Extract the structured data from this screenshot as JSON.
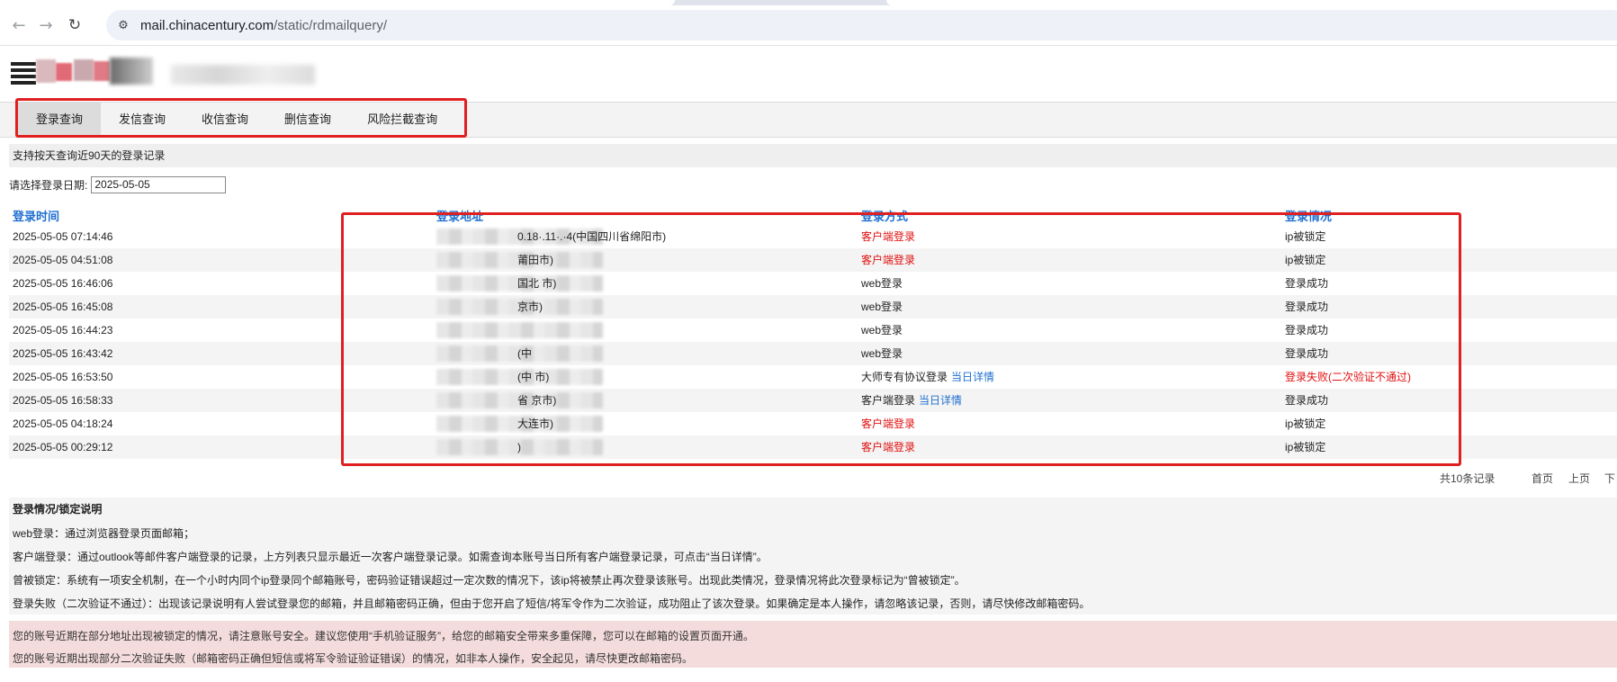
{
  "browser": {
    "url_host": "mail.chinacentury.com",
    "url_path": "/static/rdmailquery/",
    "back_icon": "arrow-left-icon",
    "forward_icon": "arrow-right-icon",
    "reload_icon": "reload-icon"
  },
  "tabs": [
    {
      "label": "登录查询",
      "active": true
    },
    {
      "label": "发信查询",
      "active": false
    },
    {
      "label": "收信查询",
      "active": false
    },
    {
      "label": "删信查询",
      "active": false
    },
    {
      "label": "风险拦截查询",
      "active": false
    }
  ],
  "info": "支持按天查询近90天的登录记录",
  "date_filter": {
    "label": "请选择登录日期:",
    "value": "2025-05-05"
  },
  "table": {
    "headers": [
      "登录时间",
      "登录地址",
      "登录方式",
      "登录情况"
    ],
    "rows": [
      {
        "time": "2025-05-05 07:14:46",
        "addr_tail": "0.18·.11·.·4(中国四川省绵阳市)",
        "method": "客户端登录",
        "method_red": true,
        "detail": "",
        "status": "ip被锁定",
        "status_red": false
      },
      {
        "time": "2025-05-05 04:51:08",
        "addr_tail": "莆田市)",
        "method": "客户端登录",
        "method_red": true,
        "detail": "",
        "status": "ip被锁定",
        "status_red": false
      },
      {
        "time": "2025-05-05 16:46:06",
        "addr_tail": "国北      市)",
        "method": "web登录",
        "method_red": false,
        "detail": "",
        "status": "登录成功",
        "status_red": false
      },
      {
        "time": "2025-05-05 16:45:08",
        "addr_tail": "京市)",
        "method": "web登录",
        "method_red": false,
        "detail": "",
        "status": "登录成功",
        "status_red": false
      },
      {
        "time": "2025-05-05 16:44:23",
        "addr_tail": "",
        "method": "web登录",
        "method_red": false,
        "detail": "",
        "status": "登录成功",
        "status_red": false
      },
      {
        "time": "2025-05-05 16:43:42",
        "addr_tail": "(中",
        "method": "web登录",
        "method_red": false,
        "detail": "",
        "status": "登录成功",
        "status_red": false
      },
      {
        "time": "2025-05-05 16:53:50",
        "addr_tail": "(中      市)",
        "method": "大师专有协议登录",
        "method_red": false,
        "detail": "当日详情",
        "status": "登录失败(二次验证不通过)",
        "status_red": true
      },
      {
        "time": "2025-05-05 16:58:33",
        "addr_tail": "省    京市)",
        "method": "客户端登录",
        "method_red": false,
        "detail": "当日详情",
        "status": "登录成功",
        "status_red": false
      },
      {
        "time": "2025-05-05 04:18:24",
        "addr_tail": "大连市)",
        "method": "客户端登录",
        "method_red": true,
        "detail": "",
        "status": "ip被锁定",
        "status_red": false
      },
      {
        "time": "2025-05-05 00:29:12",
        "addr_tail": ")",
        "method": "客户端登录",
        "method_red": true,
        "detail": "",
        "status": "ip被锁定",
        "status_red": false
      }
    ]
  },
  "pager": {
    "total": "共10条记录",
    "first": "首页",
    "prev": "上页",
    "next": "下"
  },
  "legend": {
    "title": "登录情况/锁定说明",
    "lines": [
      "web登录：通过浏览器登录页面邮箱；",
      "客户端登录：通过outlook等邮件客户端登录的记录，上方列表只显示最近一次客户端登录记录。如需查询本账号当日所有客户端登录记录，可点击“当日详情”。",
      "曾被锁定：系统有一项安全机制，在一个小时内同个ip登录同个邮箱账号，密码验证错误超过一定次数的情况下，该ip将被禁止再次登录该账号。出现此类情况，登录情况将此次登录标记为“曾被锁定”。",
      "登录失败（二次验证不通过）：出现该记录说明有人尝试登录您的邮箱，并且邮箱密码正确，但由于您开启了短信/将军令作为二次验证，成功阻止了该次登录。如果确定是本人操作，请忽略该记录，否则，请尽快修改邮箱密码。"
    ]
  },
  "warnings": [
    "您的账号近期在部分地址出现被锁定的情况，请注意账号安全。建议您使用“手机验证服务”，给您的邮箱安全带来多重保障，您可以在邮箱的设置页面开通。",
    "您的账号近期出现部分二次验证失败（邮箱密码正确但短信或将军令验证验证错误）的情况，如非本人操作，安全起见，请尽快更改邮箱密码。"
  ]
}
